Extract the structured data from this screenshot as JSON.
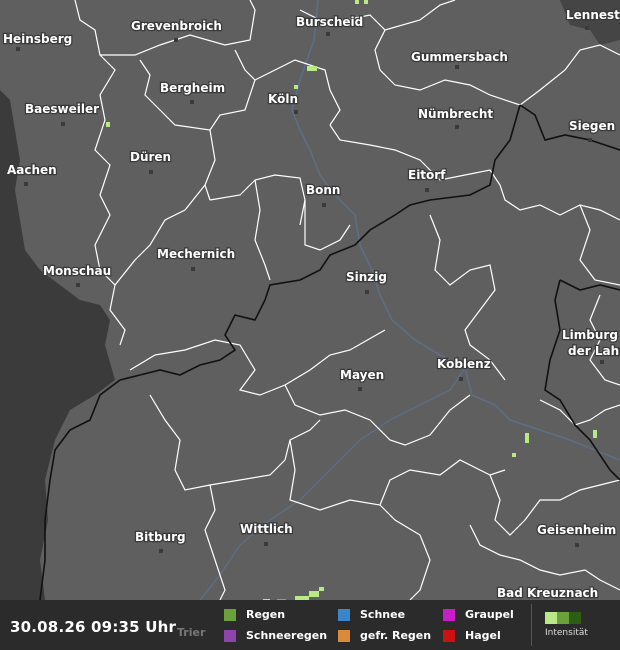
{
  "map": {
    "cities": [
      {
        "name": "Heinsberg"
      },
      {
        "name": "Grevenbroich"
      },
      {
        "name": "Burscheid"
      },
      {
        "name": "Lennestadt"
      },
      {
        "name": "Gummersbach"
      },
      {
        "name": "Bergheim"
      },
      {
        "name": "Köln"
      },
      {
        "name": "Baesweiler"
      },
      {
        "name": "Nümbrecht"
      },
      {
        "name": "Siegen"
      },
      {
        "name": "Düren"
      },
      {
        "name": "Aachen"
      },
      {
        "name": "Eitorf"
      },
      {
        "name": "Bonn"
      },
      {
        "name": "Mechernich"
      },
      {
        "name": "Monschau"
      },
      {
        "name": "Sinzig"
      },
      {
        "name": "Limburg"
      },
      {
        "name": "der Lahn"
      },
      {
        "name": "Mayen"
      },
      {
        "name": "Koblenz"
      },
      {
        "name": "Bitburg"
      },
      {
        "name": "Wittlich"
      },
      {
        "name": "Geisenheim"
      },
      {
        "name": "Bad Kreuznach"
      },
      {
        "name": "Trier"
      }
    ],
    "colors": {
      "land": "#5f5f5f",
      "outside_region": "#3b3b3b",
      "district_border": "#ffffff",
      "country_border": "#000000",
      "river": "#5c6f86",
      "rain_light": "#b8e986",
      "rain_medium": "#7fb24a"
    }
  },
  "legend": {
    "timestamp": "30.08.26 09:35 Uhr",
    "items": [
      {
        "label": "Regen",
        "color": "#6aa13a"
      },
      {
        "label": "Schneeregen",
        "color": "#8e44ad"
      },
      {
        "label": "Schnee",
        "color": "#3a86c8"
      },
      {
        "label": "gefr. Regen",
        "color": "#d98a3a"
      },
      {
        "label": "Graupel",
        "color": "#c81ec8"
      },
      {
        "label": "Hagel",
        "color": "#cc1111"
      }
    ],
    "intensity": {
      "label": "Intensität",
      "colors": [
        "#b8e986",
        "#6aa13a",
        "#2e5e16"
      ]
    }
  }
}
